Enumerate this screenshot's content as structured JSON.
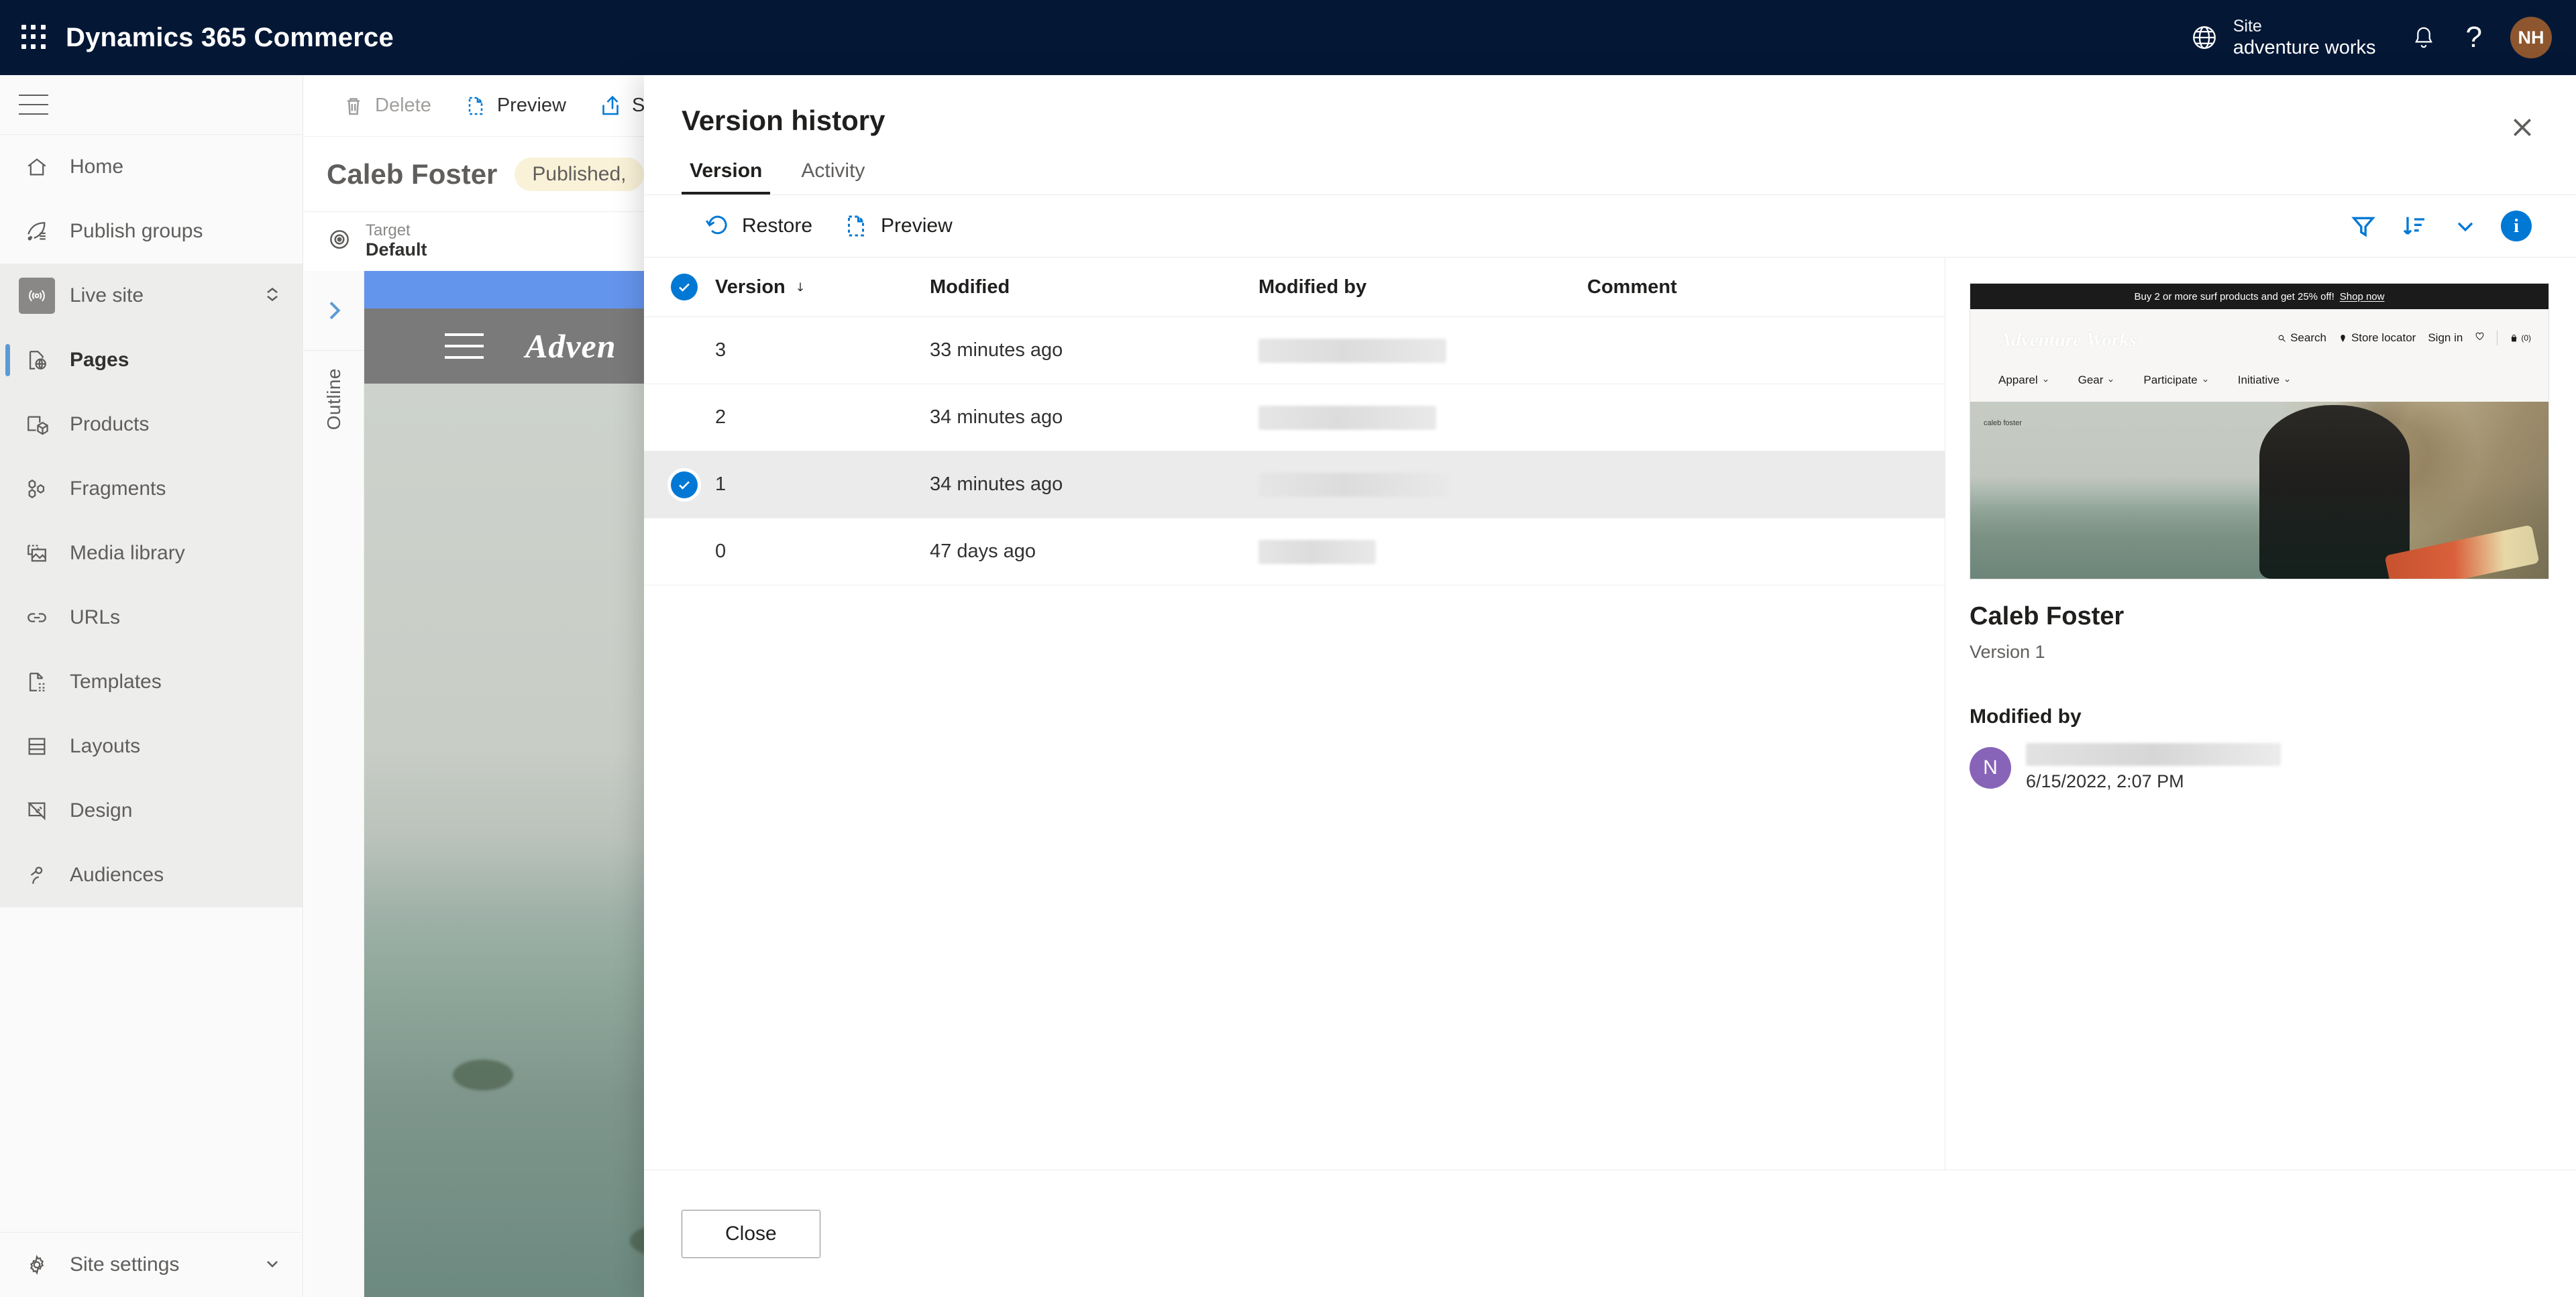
{
  "header": {
    "app_title": "Dynamics 365 Commerce",
    "waffle_icon": "grid-waffle-icon",
    "globe_icon": "globe-icon",
    "site_label": "Site",
    "site_name": "adventure works",
    "bell_icon": "notification-bell-icon",
    "help_icon": "question-mark-icon",
    "help_label": "?",
    "avatar_initials": "NH",
    "avatar_color": "#8e562e",
    "background_color": "#041836"
  },
  "sidebar": {
    "hamburger_icon": "hamburger-menu-icon",
    "items": [
      {
        "label": "Home",
        "icon": "home-icon"
      },
      {
        "label": "Publish groups",
        "icon": "rocket-list-icon"
      },
      {
        "label": "Live site",
        "icon": "broadcast-icon",
        "has_chevron": true,
        "chevron_icon": "chevron-up-down-icon"
      },
      {
        "label": "Pages",
        "icon": "page-globe-icon",
        "selected": true
      },
      {
        "label": "Products",
        "icon": "product-box-icon"
      },
      {
        "label": "Fragments",
        "icon": "fragments-icon"
      },
      {
        "label": "Media library",
        "icon": "media-image-icon"
      },
      {
        "label": "URLs",
        "icon": "link-chain-icon"
      },
      {
        "label": "Templates",
        "icon": "template-page-icon"
      },
      {
        "label": "Layouts",
        "icon": "layout-icon"
      },
      {
        "label": "Design",
        "icon": "design-ruler-icon"
      },
      {
        "label": "Audiences",
        "icon": "people-icon"
      }
    ],
    "bottom_item": {
      "label": "Site settings",
      "icon": "gear-icon",
      "chevron_icon": "chevron-down-icon"
    },
    "selected_indicator_color": "#5b9bd5"
  },
  "editor": {
    "commands": [
      {
        "label": "Delete",
        "icon": "trash-icon",
        "disabled": true
      },
      {
        "label": "Preview",
        "icon": "preview-page-icon",
        "disabled": false
      },
      {
        "label": "S",
        "icon": "share-icon",
        "disabled": false
      }
    ],
    "page_title": "Caleb Foster",
    "status_badge": "Published,",
    "target_label": "Target",
    "target_value": "Default",
    "target_icon": "target-icon",
    "outline_label": "Outline",
    "outline_expand_icon": "chevron-right-icon",
    "canvas_logo": "Adven",
    "canvas_menu_icon": "hamburger-menu-icon"
  },
  "panel": {
    "title": "Version history",
    "close_icon": "close-x-icon",
    "tabs": [
      {
        "label": "Version",
        "active": true
      },
      {
        "label": "Activity",
        "active": false
      }
    ],
    "toolbar": {
      "restore_label": "Restore",
      "restore_icon": "restore-undo-icon",
      "preview_label": "Preview",
      "preview_icon": "preview-page-icon",
      "filter_icon": "filter-funnel-icon",
      "sort_icon": "sort-descending-icon",
      "sort_chevron_icon": "chevron-down-icon",
      "info_icon": "info-circle-icon",
      "info_label": "i",
      "accent_color": "#0078d4"
    },
    "table": {
      "columns": [
        "Version",
        "Modified",
        "Modified by",
        "Comment"
      ],
      "sort_column": "Version",
      "sort_direction_icon": "arrow-down-icon",
      "header_checkbox_checked": true,
      "rows": [
        {
          "version": "3",
          "modified": "33 minutes ago",
          "modified_by": "",
          "comment": "",
          "selected": false,
          "redact_width": 280
        },
        {
          "version": "2",
          "modified": "34 minutes ago",
          "modified_by": "",
          "comment": "",
          "selected": false,
          "redact_width": 265
        },
        {
          "version": "1",
          "modified": "34 minutes ago",
          "modified_by": "",
          "comment": "",
          "selected": true,
          "redact_width": 285
        },
        {
          "version": "0",
          "modified": "47 days ago",
          "modified_by": "",
          "comment": "",
          "selected": false,
          "redact_width": 175
        }
      ]
    },
    "detail": {
      "title": "Caleb Foster",
      "subtitle": "Version 1",
      "section_label": "Modified by",
      "avatar_initial": "N",
      "avatar_color": "#8764b8",
      "modified_date": "6/15/2022, 2:07 PM",
      "thumbnail": {
        "promo_text": "Buy 2 or more surf products and get 25% off!",
        "promo_link": "Shop now",
        "logo": "Adventure Works",
        "utility_links": [
          "Search",
          "Store locator",
          "Sign in"
        ],
        "search_icon": "search-icon",
        "location_icon": "location-pin-icon",
        "wishlist_icon": "heart-icon",
        "cart_icon": "shopping-bag-icon",
        "cart_count": "(0)",
        "nav_items": [
          "Apparel",
          "Gear",
          "Participate",
          "Initiative"
        ],
        "hero_caption": "caleb foster"
      }
    },
    "footer": {
      "close_label": "Close"
    }
  }
}
